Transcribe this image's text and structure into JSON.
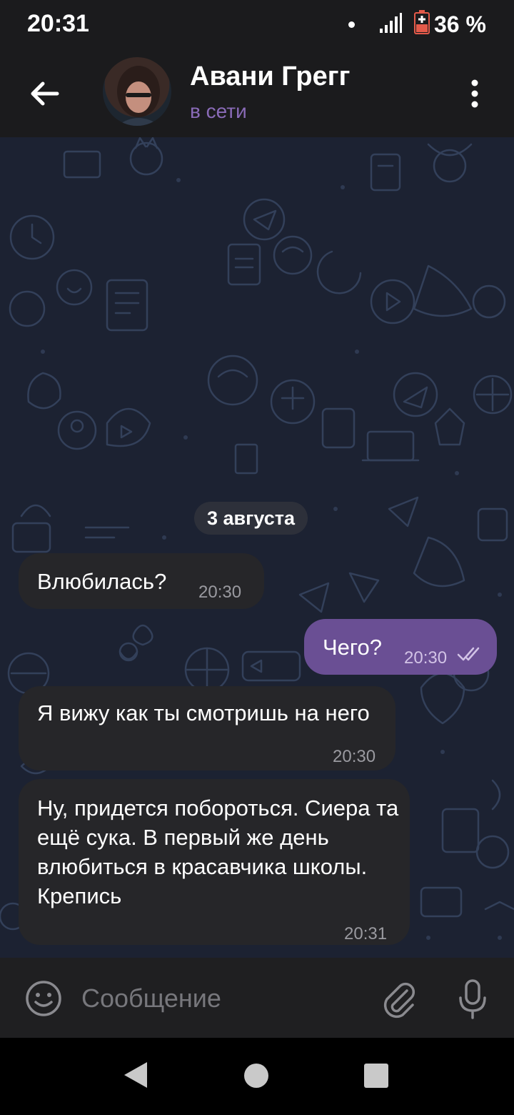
{
  "status_bar": {
    "time": "20:31",
    "battery": "36 %"
  },
  "header": {
    "name": "Авани Грегг",
    "status": "в сети"
  },
  "chat": {
    "date_separator": "3 августа",
    "messages": [
      {
        "direction": "incoming",
        "text": "Влюбилась?",
        "time": "20:30"
      },
      {
        "direction": "outgoing",
        "text": "Чего?",
        "time": "20:30",
        "read": true
      },
      {
        "direction": "incoming",
        "text": "Я вижу как ты смотришь на него",
        "time": "20:30"
      },
      {
        "direction": "incoming",
        "text": "Ну, придется побороться. Сиера та ещё сука. В первый же день влюбиться в красавчика школы. Крепись",
        "time": "20:31"
      }
    ]
  },
  "composer": {
    "placeholder": "Сообщение"
  },
  "colors": {
    "accent": "#8a6bb8",
    "outgoing_bubble": "#6a4f94",
    "incoming_bubble": "#262629",
    "wallpaper": "#1c2232"
  },
  "icons": [
    "arrow-back-icon",
    "more-vert-icon",
    "emoji-icon",
    "attach-icon",
    "mic-icon",
    "double-check-icon",
    "signal-icon",
    "battery-icon"
  ]
}
